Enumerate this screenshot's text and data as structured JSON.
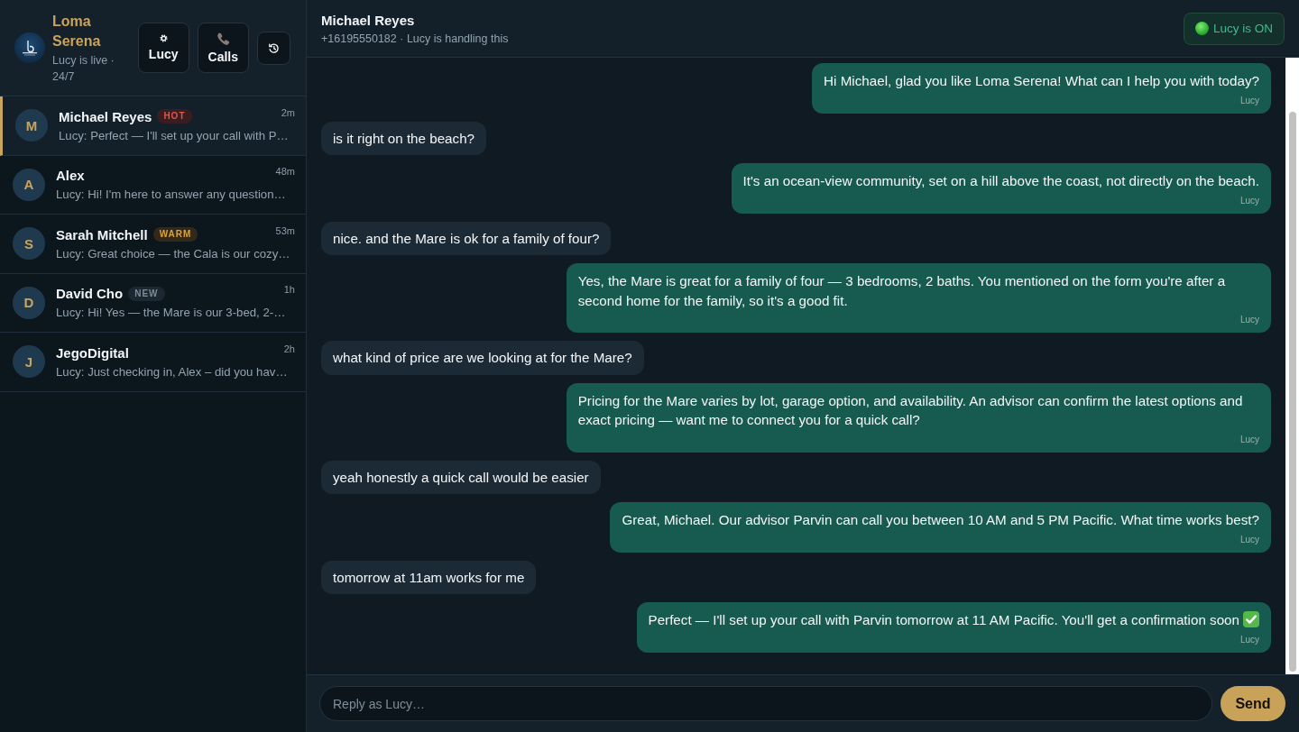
{
  "sidebar": {
    "brand": {
      "name": "Loma Serena",
      "status": "Lucy is live · 24/7"
    },
    "toolbar": [
      {
        "kind": "lucy",
        "label": "Lucy"
      },
      {
        "kind": "calls",
        "label": "Calls"
      },
      {
        "kind": "history"
      }
    ],
    "conversations": [
      {
        "initial": "M",
        "name": "Michael Reyes",
        "tag": {
          "label": "HOT",
          "kind": "hot"
        },
        "time": "2m",
        "preview": "Lucy: Perfect — I'll set up your call with P…",
        "selected": true
      },
      {
        "initial": "A",
        "name": "Alex",
        "time": "48m",
        "preview": "Lucy: Hi! I'm here to answer any question…",
        "selected": false
      },
      {
        "initial": "S",
        "name": "Sarah Mitchell",
        "tag": {
          "label": "WARM",
          "kind": "warm"
        },
        "time": "53m",
        "preview": "Lucy: Great choice — the Cala is our cozy…",
        "selected": false
      },
      {
        "initial": "D",
        "name": "David Cho",
        "tag": {
          "label": "NEW",
          "kind": "new"
        },
        "time": "1h",
        "preview": "Lucy: Hi! Yes — the Mare is our 3-bed, 2-…",
        "selected": false
      },
      {
        "initial": "J",
        "name": "JegoDigital",
        "time": "2h",
        "preview": "Lucy: Just checking in, Alex – did you hav…",
        "selected": false
      }
    ]
  },
  "chat": {
    "contact": "Michael Reyes",
    "subtitle": "+16195550182 · Lucy is handling this",
    "lucy_toggle": {
      "label": "Lucy is ON",
      "on": true
    },
    "messages": [
      {
        "kind": "outgoing",
        "text": "Hi Michael, glad you like Loma Serena! What can I help you with today?",
        "sender": "Lucy",
        "check_mark": false
      },
      {
        "kind": "incoming",
        "text": "is it right on the beach?",
        "check_mark": false
      },
      {
        "kind": "outgoing",
        "text": "It's an ocean-view community, set on a hill above the coast, not directly on the beach.",
        "sender": "Lucy",
        "check_mark": false
      },
      {
        "kind": "incoming",
        "text": "nice. and the Mare is ok for a family of four?",
        "check_mark": false
      },
      {
        "kind": "outgoing",
        "text": "Yes, the Mare is great for a family of four — 3 bedrooms, 2 baths. You mentioned on the form you're after a second home for the family, so it's a good fit.",
        "sender": "Lucy",
        "check_mark": false
      },
      {
        "kind": "incoming",
        "text": "what kind of price are we looking at for the Mare?",
        "check_mark": false
      },
      {
        "kind": "outgoing",
        "text": "Pricing for the Mare varies by lot, garage option, and availability. An advisor can confirm the latest options and exact pricing — want me to connect you for a quick call?",
        "sender": "Lucy",
        "check_mark": false
      },
      {
        "kind": "incoming",
        "text": "yeah honestly a quick call would be easier",
        "check_mark": false
      },
      {
        "kind": "outgoing",
        "text": "Great, Michael. Our advisor Parvin can call you between 10 AM and 5 PM Pacific. What time works best?",
        "sender": "Lucy",
        "check_mark": false
      },
      {
        "kind": "incoming",
        "text": "tomorrow at 11am works for me",
        "check_mark": false
      },
      {
        "kind": "outgoing",
        "text": "Perfect — I'll set up your call with Parvin tomorrow at 11 AM Pacific. You'll get a confirmation soon",
        "sender": "Lucy",
        "check_mark": true
      }
    ]
  },
  "composer": {
    "placeholder": "Reply as Lucy…",
    "send": "Send"
  }
}
